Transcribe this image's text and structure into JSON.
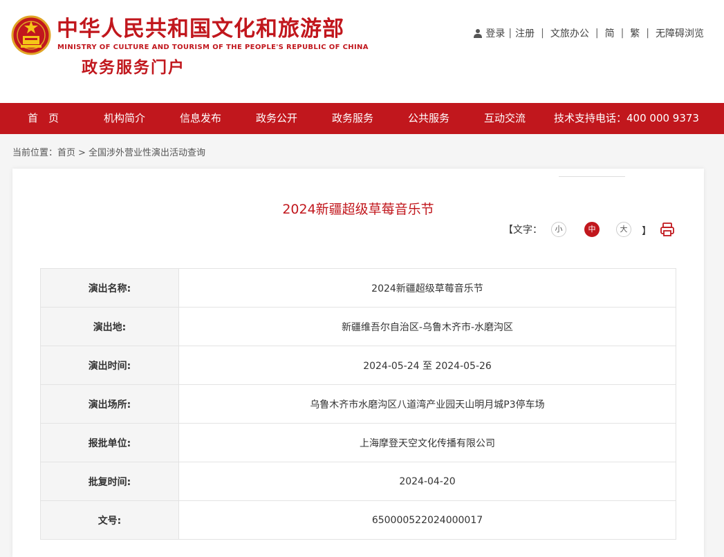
{
  "header": {
    "title_cn": "中华人民共和国文化和旅游部",
    "title_en": "MINISTRY OF CULTURE AND TOURISM OF THE PEOPLE'S REPUBLIC OF CHINA",
    "subtitle": "政务服务门户",
    "brand_color": "#c1171d"
  },
  "toplinks": {
    "login": "登录",
    "register": "注册",
    "office": "文旅办公",
    "simplified": "简",
    "traditional": "繁",
    "accessibility": "无障碍浏览",
    "separator": "|"
  },
  "nav": {
    "items": [
      "首　页",
      "机构简介",
      "信息发布",
      "政务公开",
      "政务服务",
      "公共服务",
      "互动交流"
    ],
    "hotline": "技术支持电话：400 000 9373"
  },
  "breadcrumb": {
    "prefix": "当前位置：",
    "home": "首页",
    "arrow": ">",
    "current": "全国涉外营业性演出活动查询"
  },
  "article": {
    "title": "2024新疆超级草莓音乐节",
    "font_label_open": "【文字：",
    "font_label_close": "】",
    "font_small": "小",
    "font_medium": "中",
    "font_large": "大",
    "active_font": "中"
  },
  "table": {
    "rows": [
      {
        "label": "演出名称:",
        "value": "2024新疆超级草莓音乐节"
      },
      {
        "label": "演出地:",
        "value": "新疆维吾尔自治区-乌鲁木齐市-水磨沟区"
      },
      {
        "label": "演出时间:",
        "value": "2024-05-24 至 2024-05-26"
      },
      {
        "label": "演出场所:",
        "value": "乌鲁木齐市水磨沟区八道湾产业园天山明月城P3停车场"
      },
      {
        "label": "报批单位:",
        "value": "上海摩登天空文化传播有限公司"
      },
      {
        "label": "批复时间:",
        "value": "2024-04-20"
      },
      {
        "label": "文号:",
        "value": "650000522024000017"
      }
    ]
  }
}
